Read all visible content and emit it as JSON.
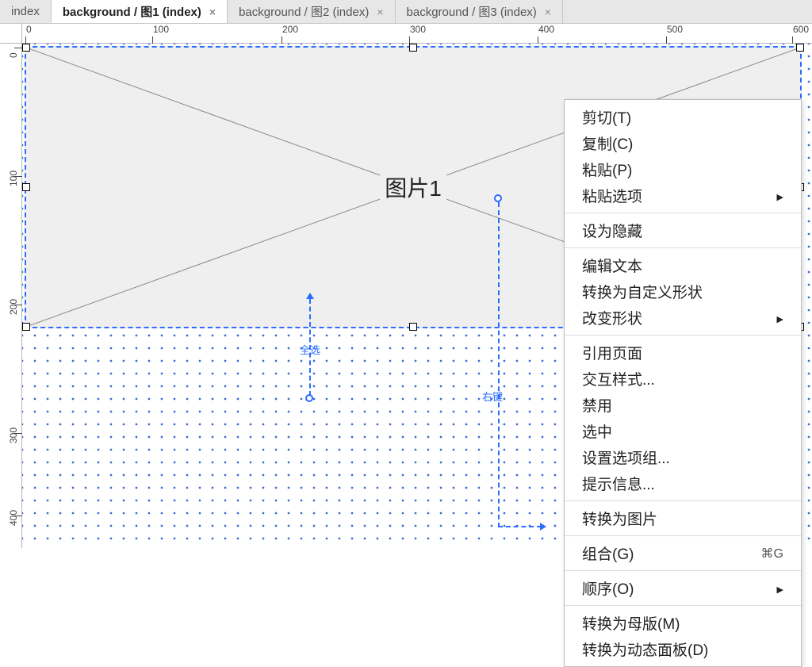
{
  "tabs": [
    {
      "label": "index",
      "active": false,
      "closeable": false
    },
    {
      "label": "background / 图1 (index)",
      "active": true,
      "closeable": true
    },
    {
      "label": "background / 图2 (index)",
      "active": false,
      "closeable": true
    },
    {
      "label": "background / 图3 (index)",
      "active": false,
      "closeable": true
    }
  ],
  "ruler_h": [
    0,
    100,
    200,
    300,
    400,
    500,
    600
  ],
  "ruler_v": [
    0,
    100,
    200,
    300,
    400
  ],
  "widget": {
    "label": "图片1"
  },
  "annotations": {
    "select_all": "全选",
    "right_click": "右键"
  },
  "menu": [
    [
      {
        "label": "剪切(T)"
      },
      {
        "label": "复制(C)"
      },
      {
        "label": "粘贴(P)"
      },
      {
        "label": "粘贴选项",
        "submenu": true
      }
    ],
    [
      {
        "label": "设为隐藏"
      }
    ],
    [
      {
        "label": "编辑文本"
      },
      {
        "label": "转换为自定义形状"
      },
      {
        "label": "改变形状",
        "submenu": true
      }
    ],
    [
      {
        "label": "引用页面"
      },
      {
        "label": "交互样式..."
      },
      {
        "label": "禁用"
      },
      {
        "label": "选中"
      },
      {
        "label": "设置选项组..."
      },
      {
        "label": "提示信息..."
      }
    ],
    [
      {
        "label": "转换为图片"
      }
    ],
    [
      {
        "label": "组合(G)",
        "shortcut": "⌘G"
      }
    ],
    [
      {
        "label": "顺序(O)",
        "submenu": true
      }
    ],
    [
      {
        "label": "转换为母版(M)"
      },
      {
        "label": "转换为动态面板(D)"
      }
    ]
  ]
}
